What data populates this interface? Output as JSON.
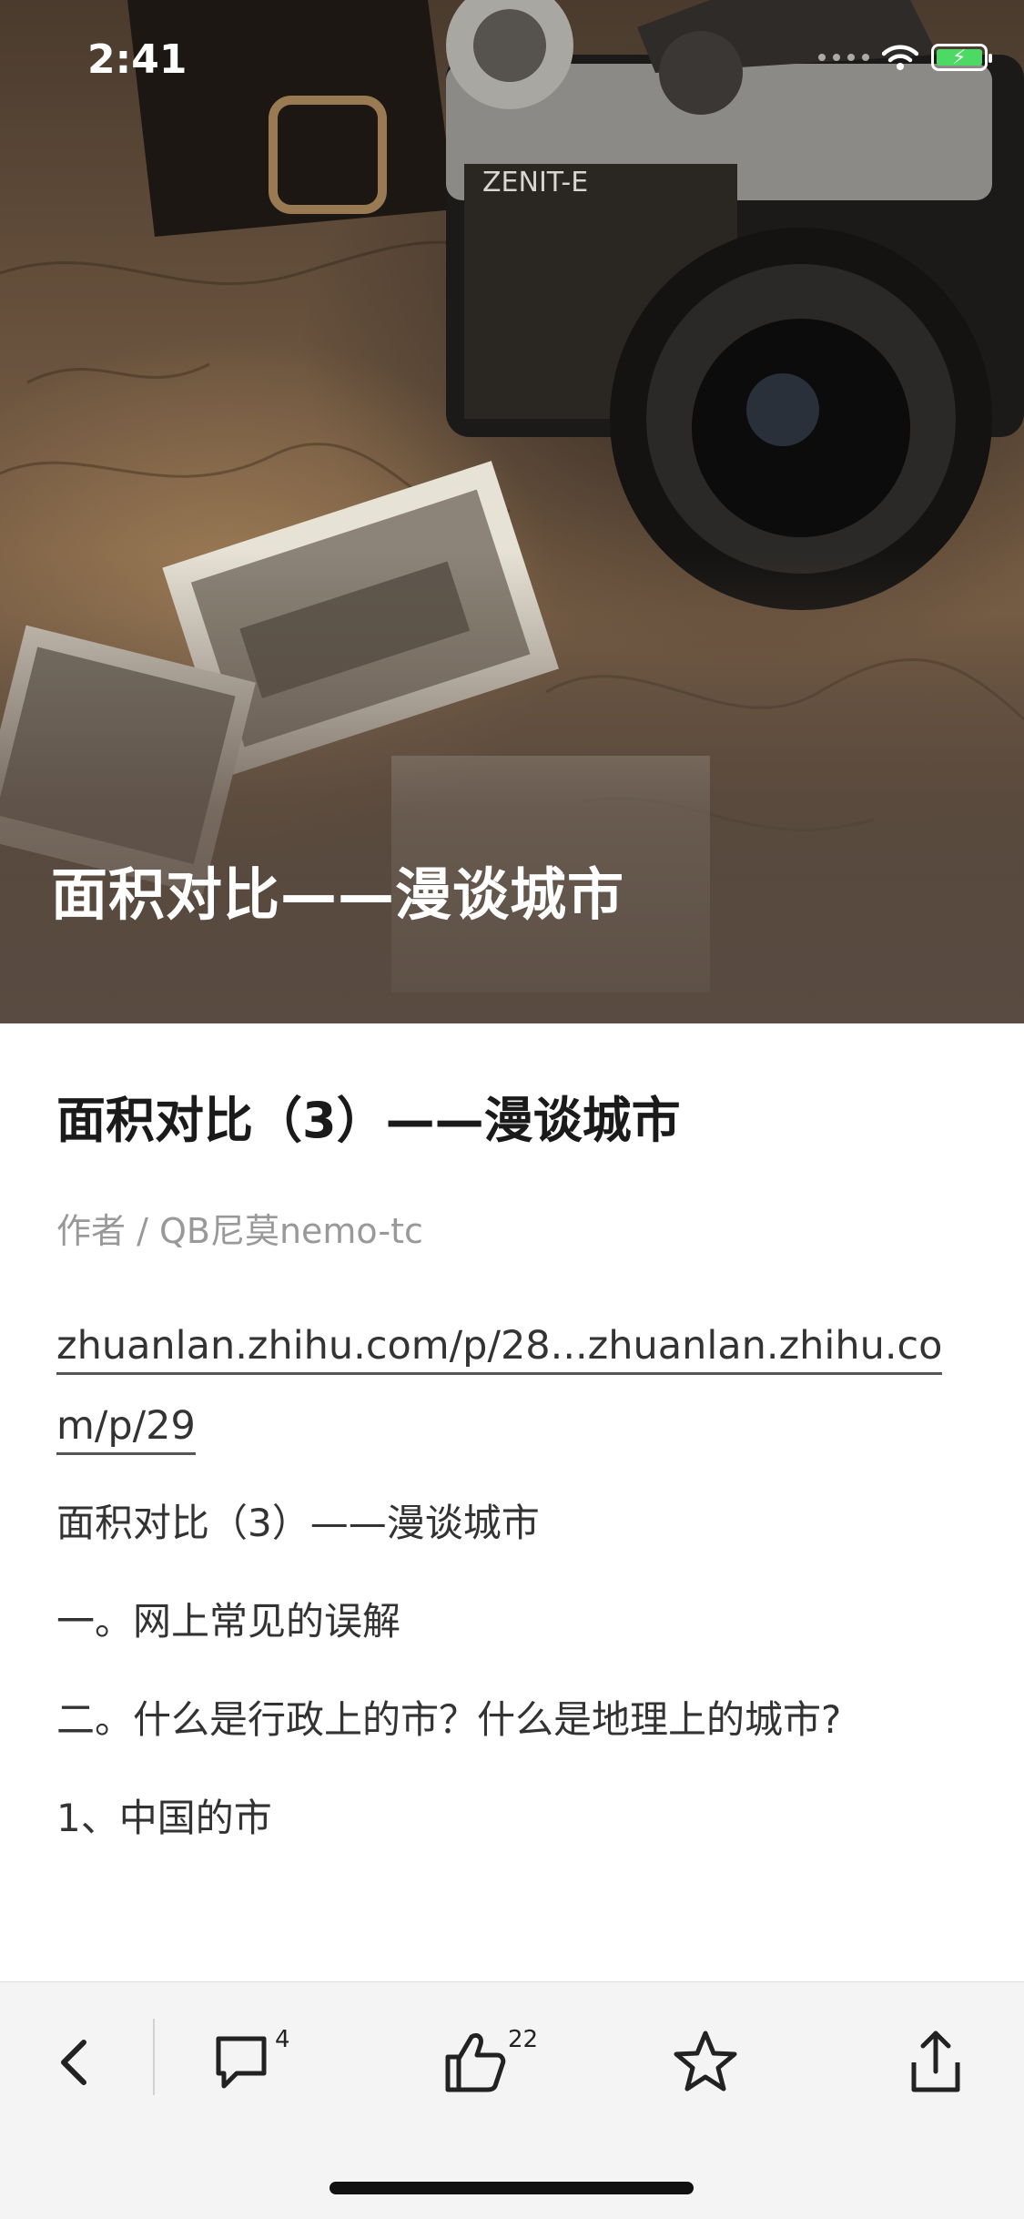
{
  "status": {
    "time": "2:41"
  },
  "hero": {
    "title": "面积对比——漫谈城市"
  },
  "article": {
    "title": "面积对比（3）——漫谈城市",
    "author": "作者 / QB尼莫nemo-tc",
    "link_text": "zhuanlan.zhihu.com/p/28...zhuanlan.zhihu.com/p/29",
    "paragraphs": [
      "面积对比（3）——漫谈城市",
      "一。网上常见的误解",
      "二。什么是行政上的市？什么是地理上的城市?",
      "1、中国的市"
    ]
  },
  "toolbar": {
    "comment_count": "4",
    "like_count": "22"
  },
  "colors": {
    "toolbar_bg": "#f4f4f4",
    "battery_green": "#4cd964",
    "text": "#333333",
    "muted": "#999999"
  },
  "icons": [
    "back-icon",
    "comment-icon",
    "like-icon",
    "star-icon",
    "share-icon",
    "wifi-icon",
    "battery-icon"
  ]
}
